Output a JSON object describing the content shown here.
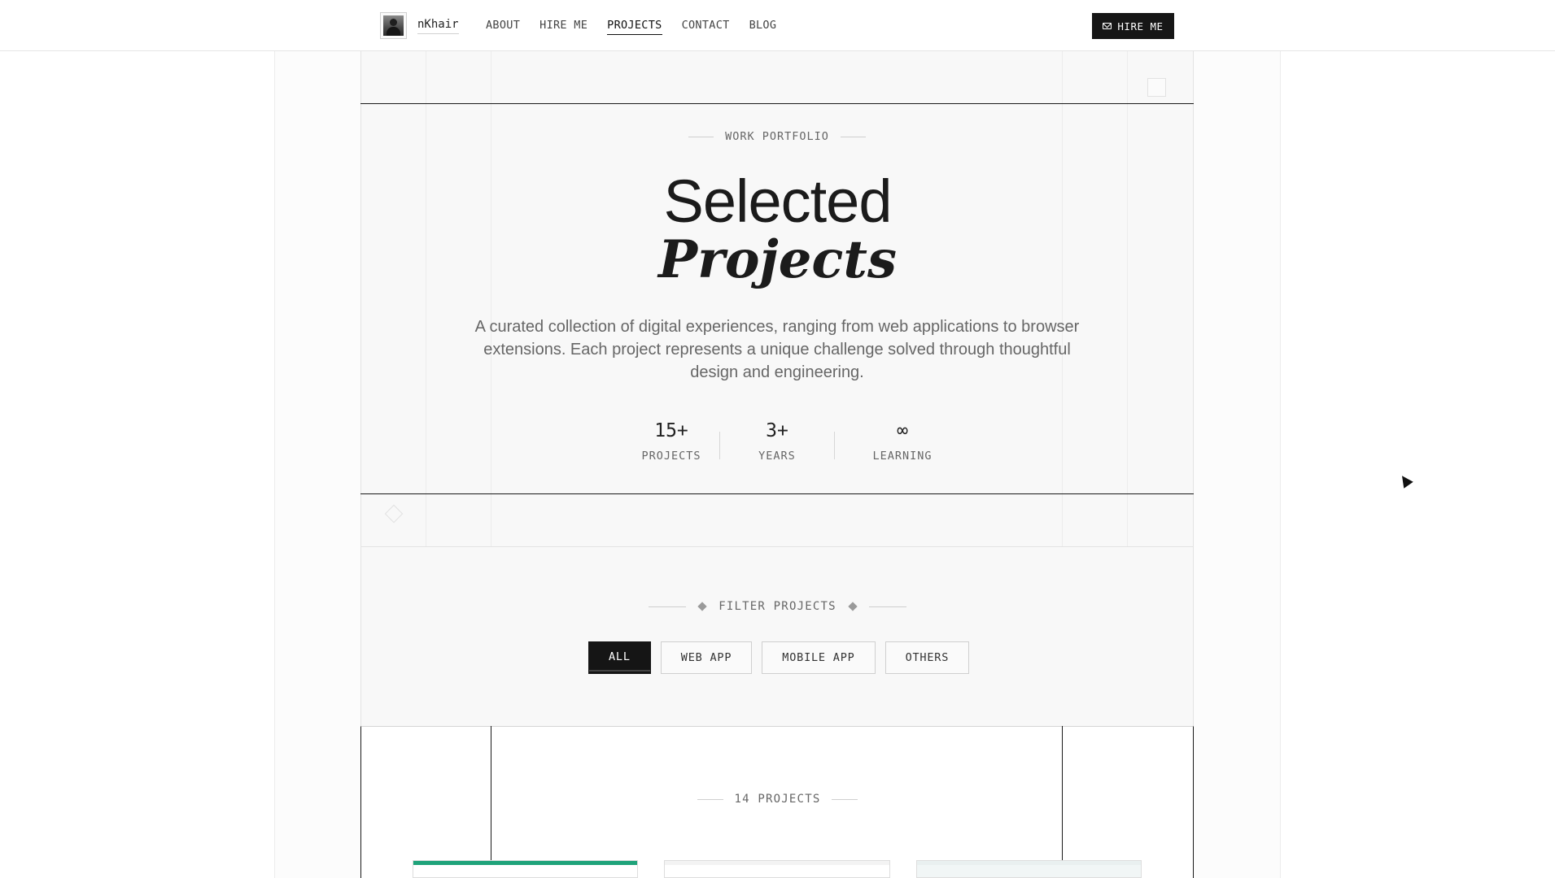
{
  "header": {
    "brand": "nKhair",
    "nav": [
      {
        "label": "ABOUT",
        "active": false
      },
      {
        "label": "HIRE ME",
        "active": false
      },
      {
        "label": "PROJECTS",
        "active": true
      },
      {
        "label": "CONTACT",
        "active": false
      },
      {
        "label": "BLOG",
        "active": false
      }
    ],
    "cta_label": "HIRE ME",
    "cta_icon": "mail-icon"
  },
  "hero": {
    "eyebrow": "WORK PORTFOLIO",
    "title_line1": "Selected",
    "title_line2": "Projects",
    "description": "A curated collection of digital experiences, ranging from web applications to browser extensions. Each project represents a unique challenge solved through thoughtful design and engineering.",
    "stats": [
      {
        "value": "15+",
        "label": "PROJECTS"
      },
      {
        "value": "3+",
        "label": "YEARS"
      },
      {
        "value": "∞",
        "label": "LEARNING"
      }
    ]
  },
  "filter": {
    "eyebrow": "FILTER PROJECTS",
    "options": [
      {
        "label": "ALL",
        "active": true
      },
      {
        "label": "WEB APP",
        "active": false
      },
      {
        "label": "MOBILE APP",
        "active": false
      },
      {
        "label": "OTHERS",
        "active": false
      }
    ]
  },
  "projects": {
    "count_label": "14 PROJECTS"
  },
  "colors": {
    "accent": "#151515",
    "background": "#f8f8f8",
    "thumb_accent_1": "#1fa37a",
    "thumb_accent_2": "#e23b3b"
  }
}
